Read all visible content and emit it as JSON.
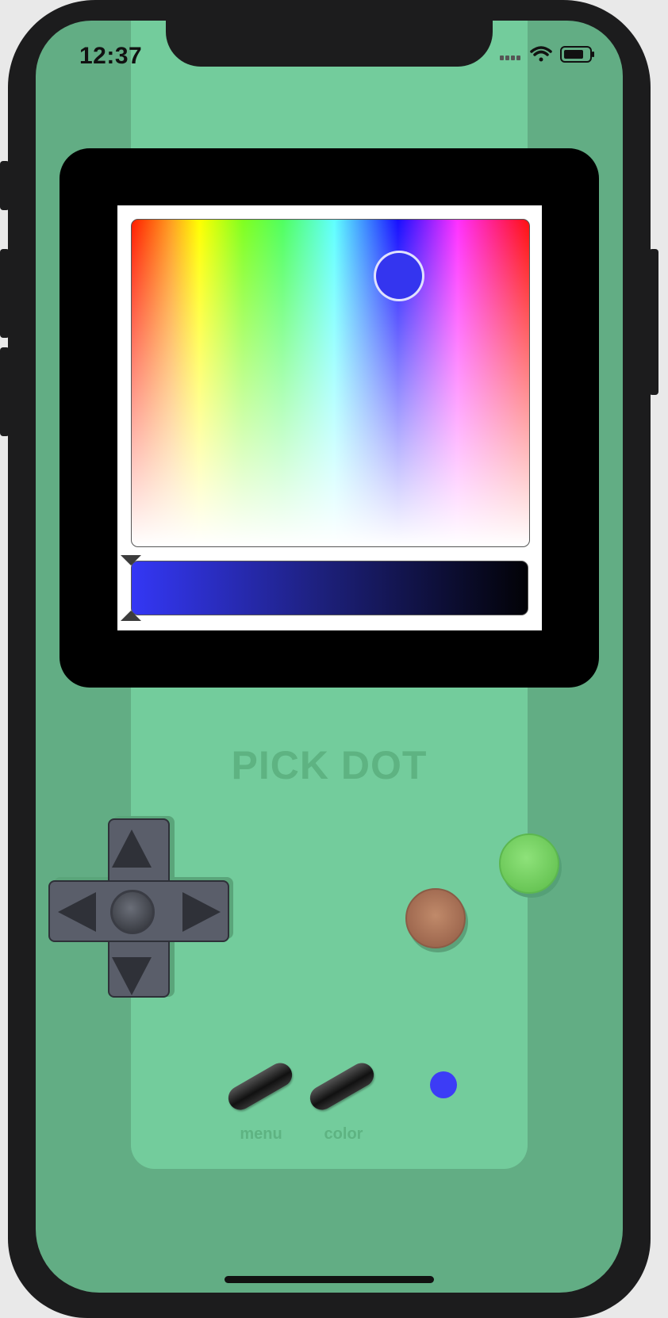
{
  "status_bar": {
    "time": "12:37",
    "signal_icon": "signal-bars-icon",
    "wifi_icon": "wifi-icon",
    "battery_icon": "battery-icon"
  },
  "color_picker": {
    "selected_color": "#3435ef",
    "brightness_level": 0.0
  },
  "title": "PICK DOT",
  "dpad": {
    "up_icon": "triangle-up-icon",
    "down_icon": "triangle-down-icon",
    "left_icon": "triangle-left-icon",
    "right_icon": "triangle-right-icon"
  },
  "buttons": {
    "b_color": "#a8755a",
    "a_color": "#6cc95b"
  },
  "controls": {
    "menu_label": "menu",
    "color_label": "color",
    "dot_color": "#3c3cf6"
  },
  "colors": {
    "frame": "#1c1c1d",
    "screen_bg": "#62ad84",
    "panel_bg": "#73cc9c",
    "title_color": "#5eb382"
  }
}
